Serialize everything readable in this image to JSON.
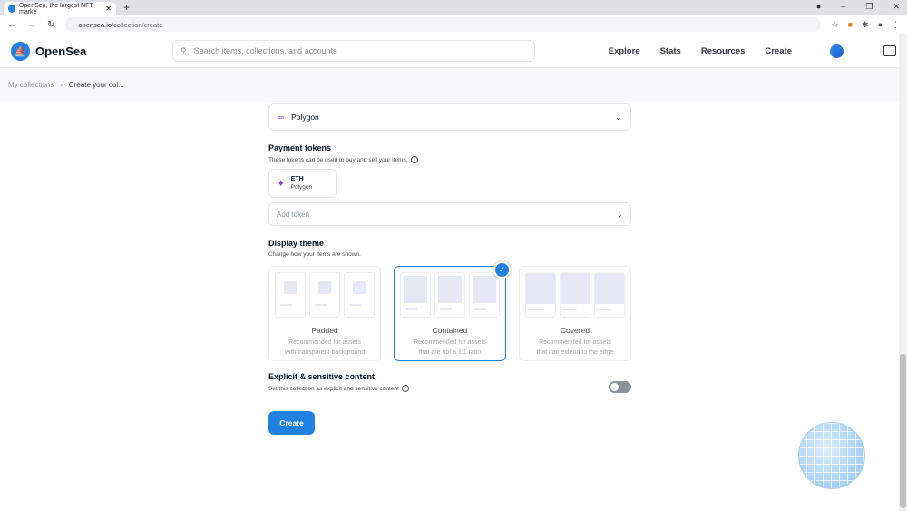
{
  "browser": {
    "tab_title": "OpenSea, the largest NFT marke",
    "url_domain": "opensea.io",
    "url_path": "/collection/create"
  },
  "header": {
    "brand": "OpenSea",
    "search_placeholder": "Search items, collections, and accounts",
    "nav": [
      "Explore",
      "Stats",
      "Resources",
      "Create"
    ]
  },
  "breadcrumb": {
    "parent": "My collections",
    "current": "Create your col..."
  },
  "form": {
    "blockchain": "Polygon",
    "payment": {
      "title": "Payment tokens",
      "subtitle": "These tokens can be used to buy and sell your items.",
      "token": {
        "name": "ETH",
        "chain": "Polygon"
      },
      "add_placeholder": "Add token"
    },
    "theme": {
      "title": "Display theme",
      "subtitle": "Change how your items are shown.",
      "options": [
        {
          "name": "Padded",
          "desc1": "Recommended for assets",
          "desc2": "with transparent background"
        },
        {
          "name": "Contained",
          "desc1": "Recommended for assets",
          "desc2": "that are not a 1:1 ratio"
        },
        {
          "name": "Covered",
          "desc1": "Recommended for assets",
          "desc2": "that can extend to the edge"
        }
      ],
      "selected": "Contained"
    },
    "explicit": {
      "title": "Explicit & sensitive content",
      "subtitle": "Set this collection as explicit and sensitive content",
      "enabled": false
    },
    "create_label": "Create"
  },
  "colors": {
    "accent": "#2081e2"
  }
}
